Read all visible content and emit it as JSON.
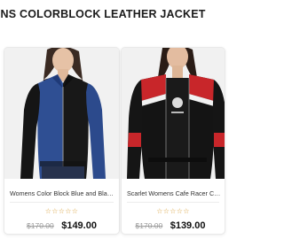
{
  "page": {
    "title": "ENS COLORBLOCK LEATHER JACKET"
  },
  "products": [
    {
      "name": "Womens Color Block Blue and Blac...",
      "old_price": "$170.00",
      "new_price": "$149.00",
      "rating_stars": 0,
      "rating_max": 5,
      "colors": {
        "primary": "#2f4f93",
        "secondary": "#141414"
      }
    },
    {
      "name": "Scarlet Womens Cafe Racer Colc",
      "old_price": "$170.00",
      "new_price": "$139.00",
      "rating_stars": 0,
      "rating_max": 5,
      "colors": {
        "primary": "#c8262a",
        "secondary": "#141414"
      }
    }
  ],
  "theme": {
    "star_color": "#d9a441",
    "old_price_color": "#999999",
    "new_price_color": "#111111"
  }
}
